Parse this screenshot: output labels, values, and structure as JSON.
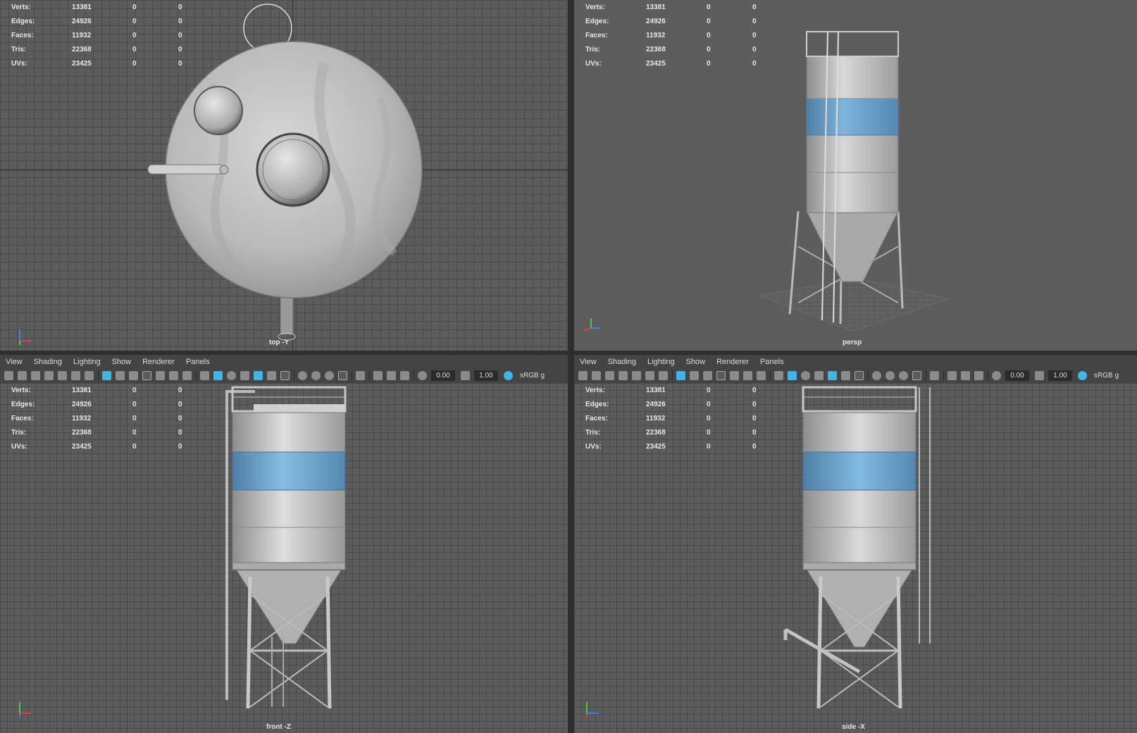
{
  "stats": {
    "rows": [
      {
        "label": "Verts:",
        "value": "13381",
        "sel1": "0",
        "sel2": "0"
      },
      {
        "label": "Edges:",
        "value": "24926",
        "sel1": "0",
        "sel2": "0"
      },
      {
        "label": "Faces:",
        "value": "11932",
        "sel1": "0",
        "sel2": "0"
      },
      {
        "label": "Tris:",
        "value": "22368",
        "sel1": "0",
        "sel2": "0"
      },
      {
        "label": "UVs:",
        "value": "23425",
        "sel1": "0",
        "sel2": "0"
      }
    ]
  },
  "panels": {
    "top": {
      "camera": "top -Y"
    },
    "persp": {
      "camera": "persp"
    },
    "front": {
      "camera": "front -Z"
    },
    "side": {
      "camera": "side -X"
    }
  },
  "menu": {
    "items": [
      "View",
      "Shading",
      "Lighting",
      "Show",
      "Renderer",
      "Panels"
    ]
  },
  "toolbar": {
    "exposure": "0.00",
    "gamma": "1.00",
    "colorspace": "sRGB g"
  },
  "colors": {
    "accent": "#3fb6e3",
    "band": "#6ea6d0",
    "metal": "#c8c8c8"
  }
}
